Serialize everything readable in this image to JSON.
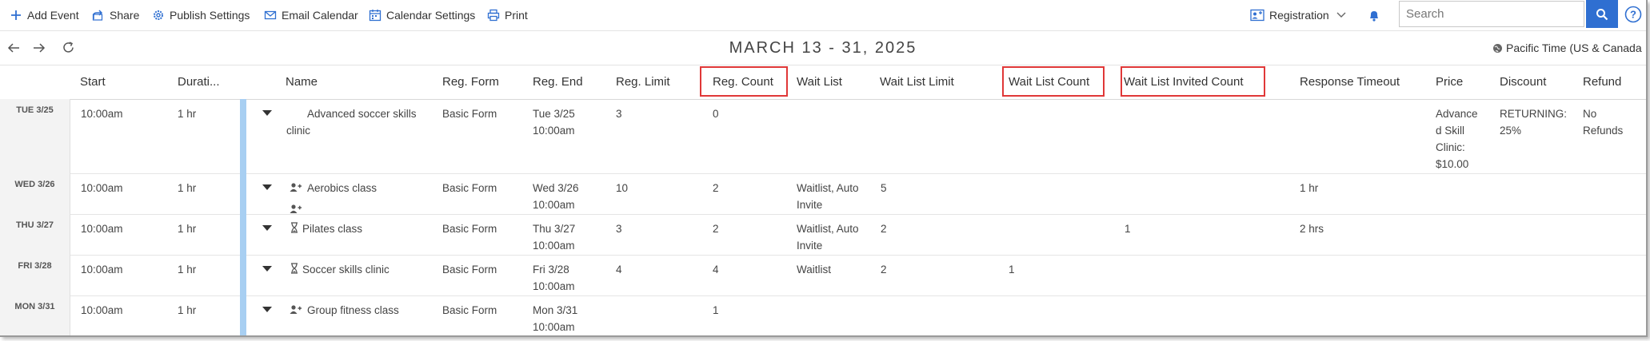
{
  "toolbar": {
    "add_event": "Add Event",
    "share": "Share",
    "publish_settings": "Publish Settings",
    "email_calendar": "Email Calendar",
    "calendar_settings": "Calendar Settings",
    "print": "Print",
    "registration": "Registration",
    "search_placeholder": "Search"
  },
  "datebar": {
    "title": "MARCH 13 - 31, 2025",
    "timezone": "Pacific Time (US & Canada"
  },
  "columns": {
    "start": "Start",
    "duration": "Durati...",
    "name": "Name",
    "reg_form": "Reg. Form",
    "reg_end": "Reg. End",
    "reg_limit": "Reg. Limit",
    "reg_count": "Reg. Count",
    "wait_list": "Wait List",
    "wait_list_limit": "Wait List Limit",
    "wait_list_count": "Wait List Count",
    "wait_list_invited_count": "Wait List Invited Count",
    "response_timeout": "Response Timeout",
    "price": "Price",
    "discount": "Discount",
    "refund": "Refund"
  },
  "rows": [
    {
      "date": "TUE 3/25",
      "start": "10:00am",
      "duration": "1 hr",
      "icon": "person-add-icon",
      "name_line1": "Advanced soccer skills",
      "name_line2": "clinic",
      "reg_form": "Basic Form",
      "reg_end_1": "Tue 3/25",
      "reg_end_2": "10:00am",
      "reg_limit": "3",
      "reg_count": "0",
      "wait_list_1": "",
      "wait_list_2": "",
      "wait_list_limit": "",
      "wait_list_count": "",
      "wait_list_invited": "",
      "response_timeout": "",
      "price_1": "Advance",
      "price_2": "d Skill",
      "price_3": "Clinic:",
      "price_4": "$10.00",
      "discount_1": "RETURNING:",
      "discount_2": "25%",
      "refund_1": "No",
      "refund_2": "Refunds"
    },
    {
      "date": "WED 3/26",
      "start": "10:00am",
      "duration": "1 hr",
      "icon": "person-add-icon",
      "name_line1": "Aerobics class",
      "name_line2": "",
      "reg_form": "Basic Form",
      "reg_end_1": "Wed 3/26",
      "reg_end_2": "10:00am",
      "reg_limit": "10",
      "reg_count": "2",
      "wait_list_1": "Waitlist, Auto",
      "wait_list_2": "Invite",
      "wait_list_limit": "5",
      "wait_list_count": "",
      "wait_list_invited": "",
      "response_timeout": "1 hr"
    },
    {
      "date": "THU 3/27",
      "start": "10:00am",
      "duration": "1 hr",
      "icon": "hourglass-icon",
      "name_line1": "Pilates class",
      "name_line2": "",
      "reg_form": "Basic Form",
      "reg_end_1": "Thu 3/27",
      "reg_end_2": "10:00am",
      "reg_limit": "3",
      "reg_count": "2",
      "wait_list_1": "Waitlist, Auto",
      "wait_list_2": "Invite",
      "wait_list_limit": "2",
      "wait_list_count": "",
      "wait_list_invited": "1",
      "response_timeout": "2 hrs"
    },
    {
      "date": "FRI 3/28",
      "start": "10:00am",
      "duration": "1 hr",
      "icon": "hourglass-icon",
      "name_line1": "Soccer skills clinic",
      "name_line2": "",
      "reg_form": "Basic Form",
      "reg_end_1": "Fri 3/28",
      "reg_end_2": "10:00am",
      "reg_limit": "4",
      "reg_count": "4",
      "wait_list_1": "Waitlist",
      "wait_list_2": "",
      "wait_list_limit": "2",
      "wait_list_count": "1",
      "wait_list_invited": "",
      "response_timeout": ""
    },
    {
      "date": "MON 3/31",
      "start": "10:00am",
      "duration": "1 hr",
      "icon": "person-add-icon",
      "name_line1": "Group fitness class",
      "name_line2": "",
      "reg_form": "Basic Form",
      "reg_end_1": "Mon 3/31",
      "reg_end_2": "10:00am",
      "reg_limit": "",
      "reg_count": "1",
      "wait_list_1": "",
      "wait_list_2": "",
      "wait_list_limit": "",
      "wait_list_count": "",
      "wait_list_invited": "",
      "response_timeout": ""
    }
  ],
  "colors": {
    "accent": "#2f6fd1",
    "highlight": "#e03838",
    "event_bar": "#a8cff2"
  }
}
